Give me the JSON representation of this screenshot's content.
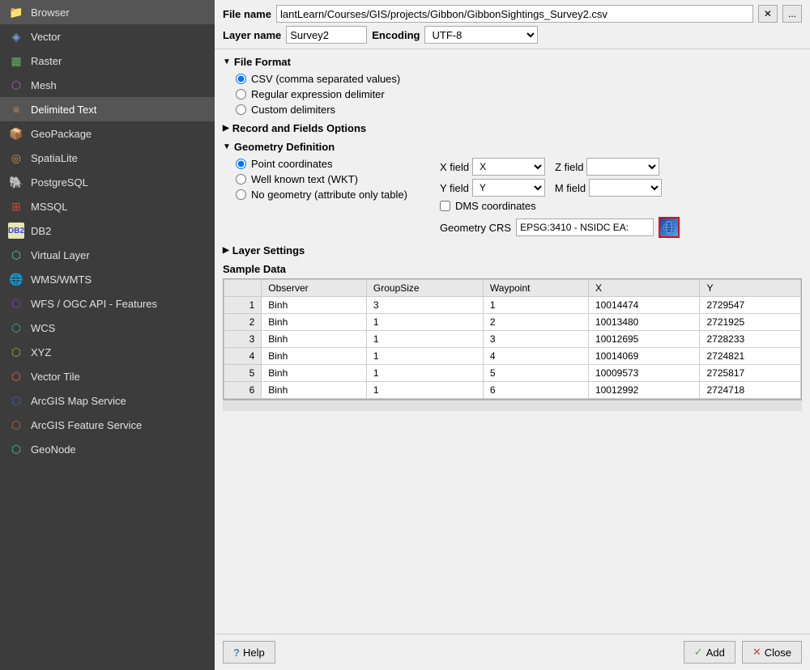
{
  "sidebar": {
    "items": [
      {
        "id": "browser",
        "label": "Browser",
        "icon": "📁"
      },
      {
        "id": "vector",
        "label": "Vector",
        "icon": "◈"
      },
      {
        "id": "raster",
        "label": "Raster",
        "icon": "▦"
      },
      {
        "id": "mesh",
        "label": "Mesh",
        "icon": "⬡"
      },
      {
        "id": "delimited-text",
        "label": "Delimited Text",
        "icon": "≡",
        "active": true
      },
      {
        "id": "geopackage",
        "label": "GeoPackage",
        "icon": "📦"
      },
      {
        "id": "spatialite",
        "label": "SpatiaLite",
        "icon": "◎"
      },
      {
        "id": "postgresql",
        "label": "PostgreSQL",
        "icon": "🐘"
      },
      {
        "id": "mssql",
        "label": "MSSQL",
        "icon": "⊞"
      },
      {
        "id": "db2",
        "label": "DB2",
        "icon": "⬡"
      },
      {
        "id": "virtual-layer",
        "label": "Virtual Layer",
        "icon": "⬡"
      },
      {
        "id": "wms",
        "label": "WMS/WMTS",
        "icon": "🌐"
      },
      {
        "id": "wfs",
        "label": "WFS / OGC API - Features",
        "icon": "⬡"
      },
      {
        "id": "wcs",
        "label": "WCS",
        "icon": "⬡"
      },
      {
        "id": "xyz",
        "label": "XYZ",
        "icon": "⬡"
      },
      {
        "id": "vector-tile",
        "label": "Vector Tile",
        "icon": "⬡"
      },
      {
        "id": "arcgis-map",
        "label": "ArcGIS Map Service",
        "icon": "⬡"
      },
      {
        "id": "arcgis-feature",
        "label": "ArcGIS Feature Service",
        "icon": "⬡"
      },
      {
        "id": "geonode",
        "label": "GeoNode",
        "icon": "⬡"
      }
    ]
  },
  "header": {
    "file_name_label": "File name",
    "file_path": "lantLearn/Courses/GIS/projects/Gibbon/GibbonSightings_Survey2.csv",
    "clear_btn": "✕",
    "more_btn": "...",
    "layer_name_label": "Layer name",
    "layer_name_value": "Survey2",
    "encoding_label": "Encoding",
    "encoding_value": "UTF-8"
  },
  "file_format": {
    "section_label": "File Format",
    "options": [
      {
        "id": "csv",
        "label": "CSV (comma separated values)",
        "checked": true
      },
      {
        "id": "regex",
        "label": "Regular expression delimiter",
        "checked": false
      },
      {
        "id": "custom",
        "label": "Custom delimiters",
        "checked": false
      }
    ]
  },
  "record_fields": {
    "section_label": "Record and Fields Options",
    "collapsed": true
  },
  "geometry": {
    "section_label": "Geometry Definition",
    "options": [
      {
        "id": "point",
        "label": "Point coordinates",
        "checked": true
      },
      {
        "id": "wkt",
        "label": "Well known text (WKT)",
        "checked": false
      },
      {
        "id": "no_geom",
        "label": "No geometry (attribute only table)",
        "checked": false
      }
    ],
    "x_field_label": "X field",
    "x_field_value": "X",
    "z_field_label": "Z field",
    "z_field_value": "",
    "y_field_label": "Y field",
    "y_field_value": "Y",
    "m_field_label": "M field",
    "m_field_value": "",
    "dms_label": "DMS coordinates",
    "crs_label": "Geometry CRS",
    "crs_value": "EPSG:3410 - NSIDC EA:"
  },
  "layer_settings": {
    "section_label": "Layer Settings",
    "collapsed": true
  },
  "sample_data": {
    "label": "Sample Data",
    "columns": [
      "",
      "Observer",
      "GroupSize",
      "Waypoint",
      "X",
      "Y"
    ],
    "rows": [
      {
        "num": "1",
        "observer": "Binh",
        "groupsize": "3",
        "waypoint": "1",
        "x": "10014474",
        "y": "2729547"
      },
      {
        "num": "2",
        "observer": "Binh",
        "groupsize": "1",
        "waypoint": "2",
        "x": "10013480",
        "y": "2721925"
      },
      {
        "num": "3",
        "observer": "Binh",
        "groupsize": "1",
        "waypoint": "3",
        "x": "10012695",
        "y": "2728233"
      },
      {
        "num": "4",
        "observer": "Binh",
        "groupsize": "1",
        "waypoint": "4",
        "x": "10014069",
        "y": "2724821"
      },
      {
        "num": "5",
        "observer": "Binh",
        "groupsize": "1",
        "waypoint": "5",
        "x": "10009573",
        "y": "2725817"
      },
      {
        "num": "6",
        "observer": "Binh",
        "groupsize": "1",
        "waypoint": "6",
        "x": "10012992",
        "y": "2724718"
      }
    ]
  },
  "footer": {
    "help_label": "Help",
    "add_label": "Add",
    "close_label": "Close"
  }
}
